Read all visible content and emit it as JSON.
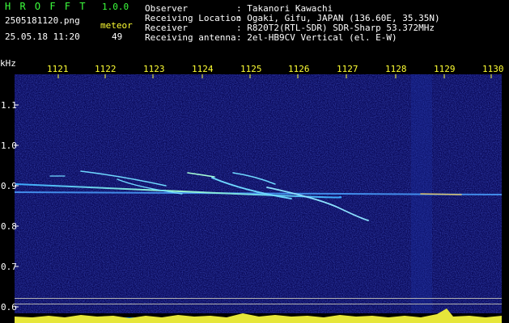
{
  "app": {
    "name": "H R O F F T",
    "version": "1.0.0",
    "filename": "2505181120.png",
    "datetime": "25.05.18 11:20",
    "meteor_label": "meteor",
    "meteor_count": "49"
  },
  "info": {
    "observer_label": "Observer",
    "observer_value": ": Takanori Kawachi",
    "location_label": "Receiving Location",
    "location_value": ": Ogaki, Gifu, JAPAN (136.60E, 35.35N)",
    "receiver_label": "Receiver",
    "receiver_value": ": R820T2(RTL-SDR) SDR-Sharp 53.372MHz",
    "antenna_label": "Receiving antenna",
    "antenna_value": ": 2el-HB9CV Vertical (el. E-W)"
  },
  "axes": {
    "y_unit": "kHz",
    "x_ticks": [
      "1121",
      "1122",
      "1123",
      "1124",
      "1125",
      "1126",
      "1127",
      "1128",
      "1129",
      "1130"
    ],
    "y_ticks": [
      "1.1",
      "1.0",
      "0.9",
      "0.8",
      "0.7",
      "0.6"
    ]
  },
  "colors": {
    "header_green": "#3cff3c",
    "header_white": "#ffffff",
    "tick_yellow": "#ffff33",
    "background_blue": "#0a0a5a",
    "meteor_cyan": "#5fd0ff"
  }
}
